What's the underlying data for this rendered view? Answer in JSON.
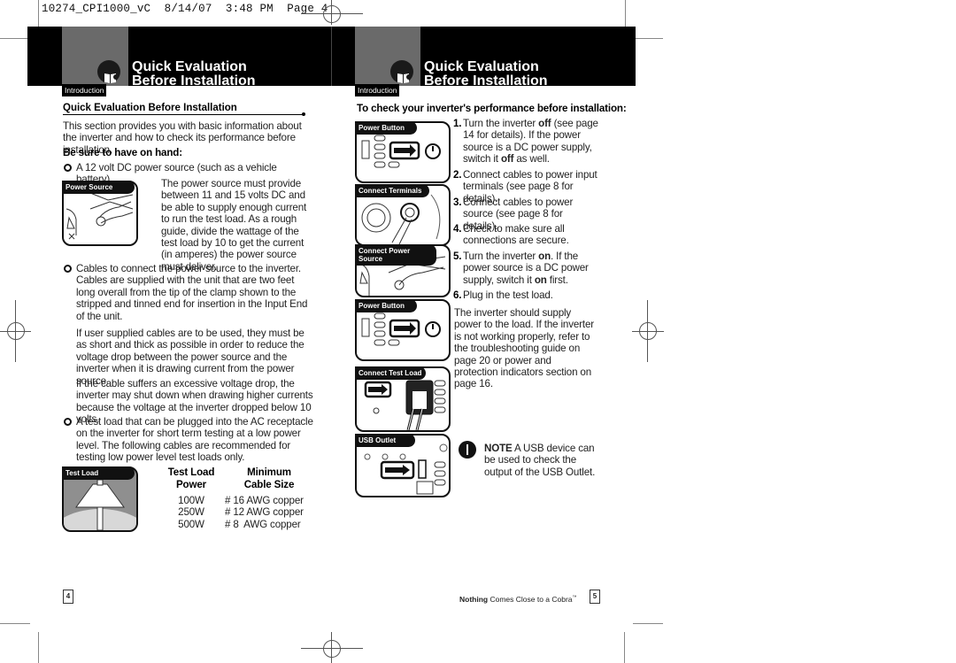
{
  "slug": "10274_CPI1000_vC  8/14/07  3:48 PM  Page 4",
  "left_page": {
    "tab_label": "Introduction",
    "title_line1": "Quick Evaluation",
    "title_line2": "Before Installation",
    "section_heading": "Quick Evaluation Before Installation",
    "intro": "This section provides you with basic information about the inverter and how to check its performance before installation.",
    "have_on_hand_heading": "Be sure to have on hand:",
    "bullet1": "A 12 volt DC power source (such as a vehicle battery).",
    "power_source_tag": "Power Source",
    "power_source_text": "The power source must provide between 11 and 15 volts DC and be able to supply enough current to run the test load. As a rough guide, divide the wattage of the test load by 10 to get the current (in amperes) the power source must deliver.",
    "bullet2": "Cables to connect the power source to the inverter. Cables are supplied with the unit that are two feet long overall from the tip of the clamp shown to the stripped and tinned end for insertion in the Input End of the unit.",
    "para_user_cables": "If user supplied cables are to be used, they must be as short and thick as possible in order to reduce the voltage drop between the power source and the inverter when it is drawing current from the power source.",
    "para_voltage_drop": "If the cable suffers an excessive voltage drop, the inverter may shut down when drawing higher currents because the voltage at the inverter dropped below 10 volts.",
    "bullet3": "A test load that can be plugged into the AC receptacle on the inverter for short term testing at a low power level. The following cables are recommended for testing low power level test loads only.",
    "test_load_tag": "Test Load",
    "table": {
      "headers": [
        [
          "Test Load",
          "Power"
        ],
        [
          "Minimum",
          "Cable Size"
        ]
      ],
      "rows": [
        [
          "100W",
          "# 16 AWG copper"
        ],
        [
          "250W",
          "# 12 AWG copper"
        ],
        [
          "500W",
          "# 8  AWG copper"
        ]
      ]
    },
    "page_number": "4"
  },
  "right_page": {
    "tab_label": "Introduction",
    "title_line1": "Quick Evaluation",
    "title_line2": "Before Installation",
    "heading": "To check your inverter's performance before installation:",
    "illustrations": [
      "Power Button",
      "Connect Terminals",
      "Connect Power Source",
      "Power Button",
      "Connect Test Load",
      "USB Outlet"
    ],
    "steps": [
      {
        "num": "1.",
        "pre": "Turn the inverter ",
        "b1": "off",
        "mid": " (see page 14 for details). If the power source is a DC power supply, switch it ",
        "b2": "off",
        "post": " as well."
      },
      {
        "num": "2.",
        "text": "Connect cables to power input terminals (see page 8 for details)."
      },
      {
        "num": "3.",
        "text": "Connect cables to power source (see page 8 for details)."
      },
      {
        "num": "4.",
        "text": "Check to make sure all connections are secure."
      },
      {
        "num": "5.",
        "pre": "Turn the inverter ",
        "b1": "on",
        "mid": ". If the power source is a DC power supply, switch it ",
        "b2": "on",
        "post": " first."
      },
      {
        "num": "6.",
        "text": "Plug in the test load."
      }
    ],
    "result_para": "The inverter should supply power to the load. If the inverter is not working properly, refer to the troubleshooting guide on page 20 or power and protection indicators section on page 16.",
    "note_label": "NOTE",
    "note_text": " A USB device can be used to check the output of the USB Outlet.",
    "footer_bold": "Nothing",
    "footer_text": " Comes Close to a Cobra",
    "footer_tm": "™",
    "page_number": "5"
  }
}
